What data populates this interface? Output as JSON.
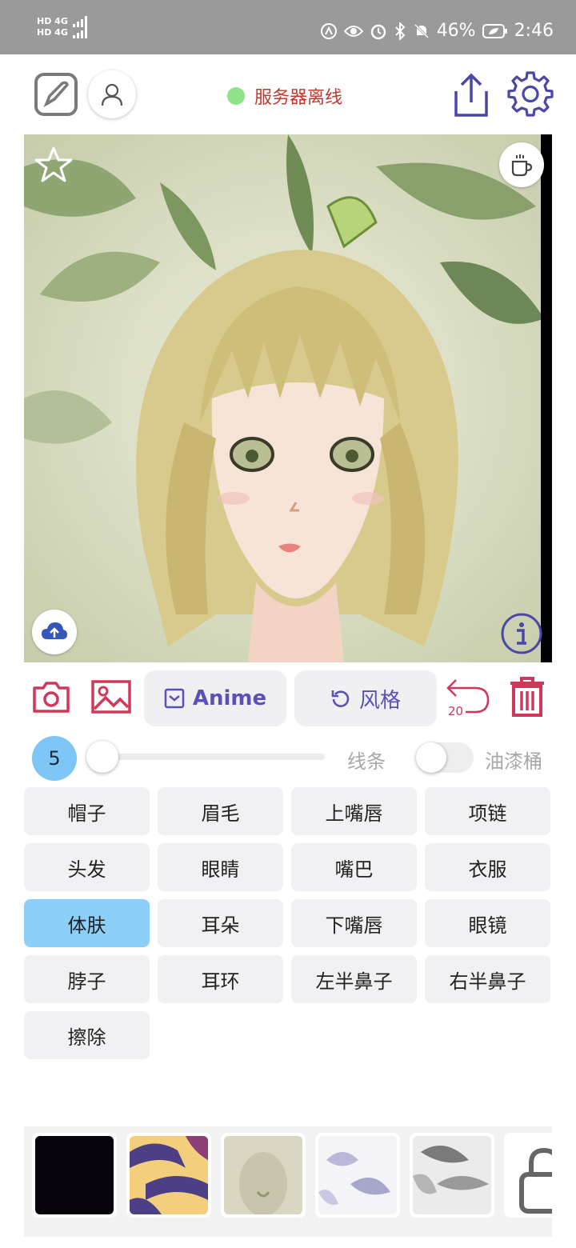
{
  "status_bar": {
    "network_top": "HD 4G",
    "network_bottom": "HD 4G",
    "battery": "46%",
    "time": "2:46"
  },
  "toolbar": {
    "server_status": "服务器离线",
    "colors": {
      "icon": "#4a47a8",
      "status_dot": "#8fe38a",
      "status_text": "#c0392b"
    }
  },
  "actions": {
    "model_label": "Anime",
    "style_label": "风格",
    "undo_count": "20",
    "accent": "#d0385a"
  },
  "brush": {
    "size": "5",
    "size_level": 0,
    "mode_label": "线条",
    "fill_label": "油漆桶",
    "fill_enabled": false
  },
  "tags": [
    "帽子",
    "眉毛",
    "上嘴唇",
    "项链",
    "头发",
    "眼睛",
    "嘴巴",
    "衣服",
    "体肤",
    "耳朵",
    "下嘴唇",
    "眼镜",
    "脖子",
    "耳环",
    "左半鼻子",
    "右半鼻子",
    "擦除"
  ],
  "active_tag": "体肤",
  "thumbnails": [
    "black",
    "tiger-stripes",
    "beige-portrait",
    "white-leaves",
    "grey-sketch",
    "locked"
  ]
}
